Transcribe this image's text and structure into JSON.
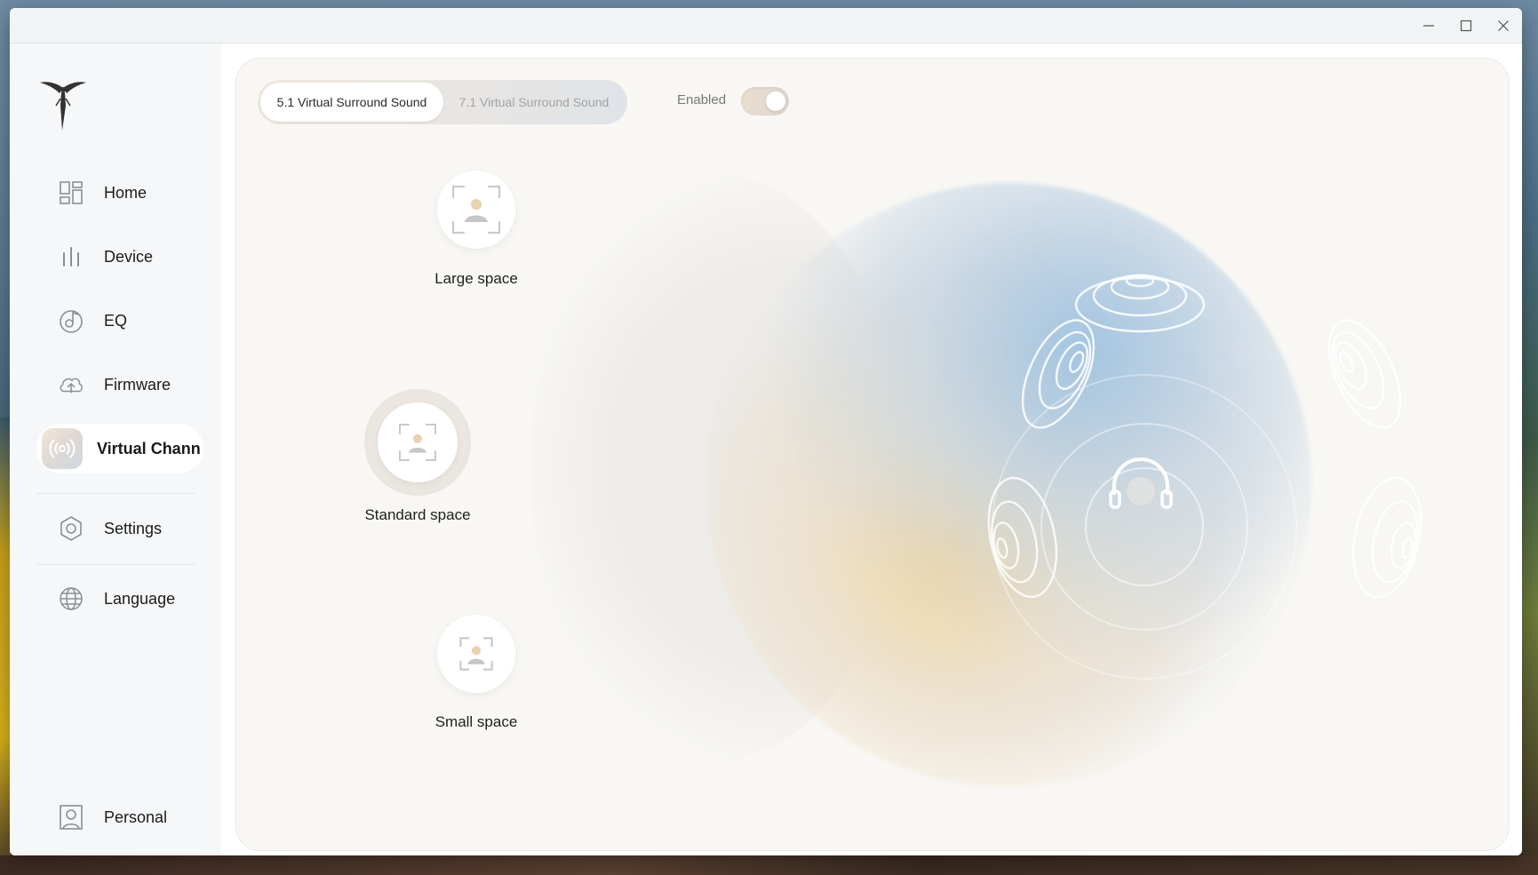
{
  "window": {
    "controls": {
      "minimize_icon": "minimize-icon",
      "maximize_icon": "maximize-icon",
      "close_icon": "close-icon"
    }
  },
  "sidebar": {
    "logo_icon": "winged-figure-logo",
    "items": [
      {
        "label": "Home",
        "icon": "dashboard-icon"
      },
      {
        "label": "Device",
        "icon": "bars-icon"
      },
      {
        "label": "EQ",
        "icon": "music-note-icon"
      },
      {
        "label": "Firmware",
        "icon": "cloud-upload-icon"
      },
      {
        "label": "Virtual Chann",
        "icon": "broadcast-icon",
        "active": true
      },
      {
        "label": "Settings",
        "icon": "hexagon-settings-icon"
      },
      {
        "label": "Language",
        "icon": "globe-icon"
      },
      {
        "label": "Personal",
        "icon": "user-icon"
      }
    ]
  },
  "main": {
    "tabs": [
      {
        "label": "5.1 Virtual Surround Sound",
        "selected": true
      },
      {
        "label": "7.1 Virtual Surround Sound",
        "selected": false
      }
    ],
    "toggle": {
      "label": "Enabled",
      "on": true
    },
    "spaces": [
      {
        "label": "Large space",
        "selected": false
      },
      {
        "label": "Standard space",
        "selected": true
      },
      {
        "label": "Small space",
        "selected": false
      }
    ]
  },
  "colors": {
    "accent_warm": "#f4d6a0",
    "accent_cool": "#a0c3e1",
    "panel_bg": "#f8f7f4",
    "sidebar_bg": "#f5f7f9"
  }
}
